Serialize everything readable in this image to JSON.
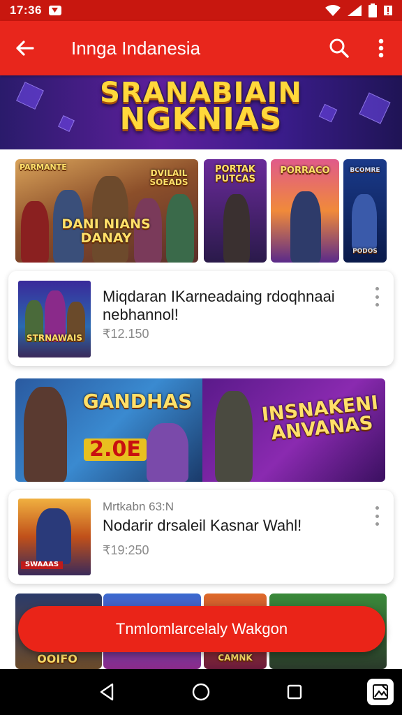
{
  "status_bar": {
    "time": "17:36"
  },
  "app_bar": {
    "title": "Innga Indanesia",
    "back_icon": "arrow-left-icon",
    "search_icon": "search-icon",
    "menu_icon": "more-vert-icon"
  },
  "hero": {
    "line1": "SRANABIAIN",
    "line2": "NGKNIAS"
  },
  "carousel": {
    "tiles": [
      {
        "top_label": "PARMANTE",
        "top_label2": "DVILAIL SOEADS",
        "main_label": "DANI NIANS DANAY"
      },
      {
        "label": "PORTAK PUTCAS"
      },
      {
        "label": "PORRACO"
      },
      {
        "label": "BCOMRE",
        "badge": "PODOS"
      }
    ]
  },
  "cards": [
    {
      "title": "Miqdaran IKarneadaing rdoqhnaai nebhannol!",
      "price": "₹12.150",
      "thumb_label": "STRNAWAIS"
    },
    {
      "subtitle": "Mrtkabn 63:N",
      "title": "Nodarir drsaleil Kasnar Wahl!",
      "price": "₹19:250",
      "thumb_label": "SWAAAS"
    }
  ],
  "promo_banner": {
    "left_label": "GANDHAS",
    "left_number": "2.0E",
    "right_label": "INSNAKENI ANVANAS"
  },
  "bottom_strip": {
    "label1": "OOIFO",
    "label2": "CAMNK"
  },
  "cta": {
    "label": "Tnmlomlarcelaly Wakgon"
  },
  "colors": {
    "primary": "#e8261c",
    "status_bar": "#c8170f",
    "card_bg": "#ffffff"
  }
}
